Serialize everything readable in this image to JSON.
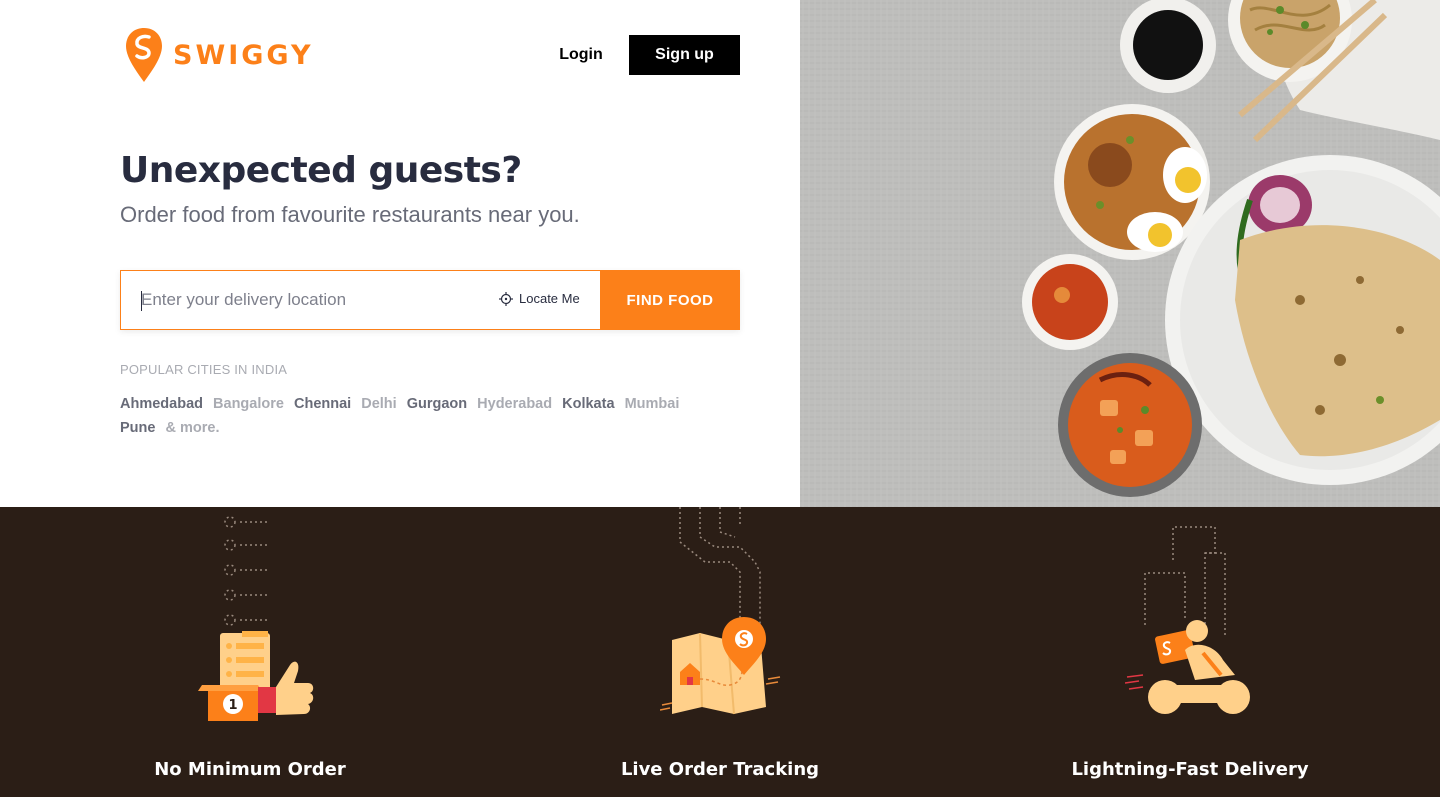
{
  "brand": {
    "name": "SWIGGY",
    "color": "#fc8019"
  },
  "header": {
    "login_label": "Login",
    "signup_label": "Sign up"
  },
  "hero": {
    "headline": "Unexpected guests?",
    "subline": "Order food from favourite restaurants near you.",
    "search_placeholder": "Enter your delivery location",
    "locate_label": "Locate Me",
    "find_label": "FIND FOOD"
  },
  "cities": {
    "title": "POPULAR CITIES IN INDIA",
    "items": [
      {
        "name": "Ahmedabad",
        "tone": "dark"
      },
      {
        "name": "Bangalore",
        "tone": "light"
      },
      {
        "name": "Chennai",
        "tone": "dark"
      },
      {
        "name": "Delhi",
        "tone": "light"
      },
      {
        "name": "Gurgaon",
        "tone": "dark"
      },
      {
        "name": "Hyderabad",
        "tone": "light"
      },
      {
        "name": "Kolkata",
        "tone": "dark"
      },
      {
        "name": "Mumbai",
        "tone": "light"
      },
      {
        "name": "Pune",
        "tone": "dark"
      }
    ],
    "more_label": "& more."
  },
  "features": [
    {
      "title": "No Minimum Order",
      "icon": "thumbs-up-order-icon"
    },
    {
      "title": "Live Order Tracking",
      "icon": "map-tracking-icon"
    },
    {
      "title": "Lightning-Fast Delivery",
      "icon": "delivery-scooter-icon"
    }
  ],
  "colors": {
    "accent": "#fc8019",
    "dark_bg": "#2b1e16",
    "text_dark": "#282c3f",
    "text_muted": "#686b78"
  }
}
